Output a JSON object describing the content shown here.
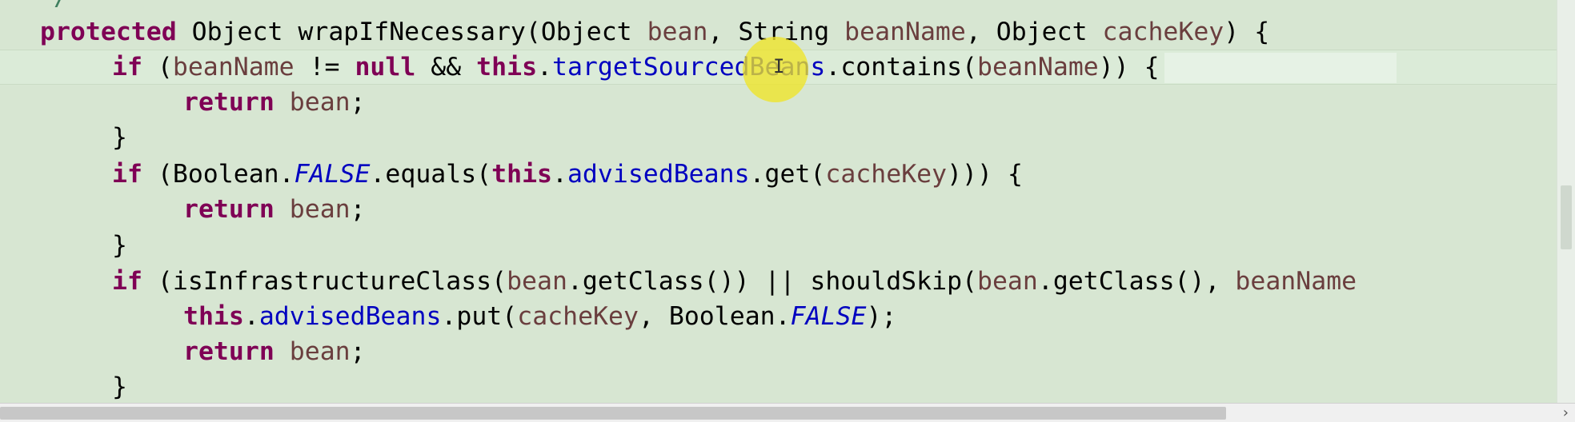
{
  "editor": {
    "lines": [
      {
        "text": "protected"
      },
      {
        "text": "if"
      },
      {
        "text": "return"
      },
      {
        "text": "}"
      },
      {
        "text": "if"
      },
      {
        "text": "return"
      },
      {
        "text": "}"
      },
      {
        "text": "if"
      },
      {
        "text": "this"
      },
      {
        "text": "return"
      },
      {
        "text": "}"
      }
    ],
    "code": {
      "l1": {
        "kw": "protected",
        "a": " Object wrapIfNecessary(Object ",
        "p1": "bean",
        "b": ", String ",
        "p2": "beanName",
        "c": ", Object ",
        "p3": "cacheKey",
        "d": ") {"
      },
      "l2": {
        "kw": "if",
        "a": " (",
        "p1": "beanName",
        "b": " != ",
        "kw2": "null",
        "c": " && ",
        "kw3": "this",
        "d": ".",
        "f1": "targetSourcedBeans",
        "e": ".contains(",
        "p2": "beanName",
        "g": ")) {"
      },
      "l3": {
        "kw": "return",
        "a": " ",
        "p1": "bean",
        "b": ";"
      },
      "l4": {
        "a": "}"
      },
      "l5": {
        "kw": "if",
        "a": " (Boolean.",
        "s1": "FALSE",
        "b": ".equals(",
        "kw2": "this",
        "c": ".",
        "f1": "advisedBeans",
        "d": ".get(",
        "p1": "cacheKey",
        "e": "))) {"
      },
      "l6": {
        "kw": "return",
        "a": " ",
        "p1": "bean",
        "b": ";"
      },
      "l7": {
        "a": "}"
      },
      "l8": {
        "kw": "if",
        "a": " (isInfrastructureClass(",
        "p1": "bean",
        "b": ".getClass()) || shouldSkip(",
        "p2": "bean",
        "c": ".getClass(), ",
        "p3": "beanName"
      },
      "l9": {
        "kw": "this",
        "a": ".",
        "f1": "advisedBeans",
        "b": ".put(",
        "p1": "cacheKey",
        "c": ", Boolean.",
        "s1": "FALSE",
        "d": ");"
      },
      "l10": {
        "kw": "return",
        "a": " ",
        "p1": "bean",
        "b": ";"
      },
      "l11": {
        "a": "}"
      }
    }
  },
  "comment_fragment": "*/",
  "scrollbar": {
    "right_arrow": "›"
  },
  "colors": {
    "background": "#d7e6d2",
    "keyword": "#7f0055",
    "field": "#0000c0",
    "parameter": "#6a3e3e",
    "cursor_highlight": "#f0e428"
  }
}
